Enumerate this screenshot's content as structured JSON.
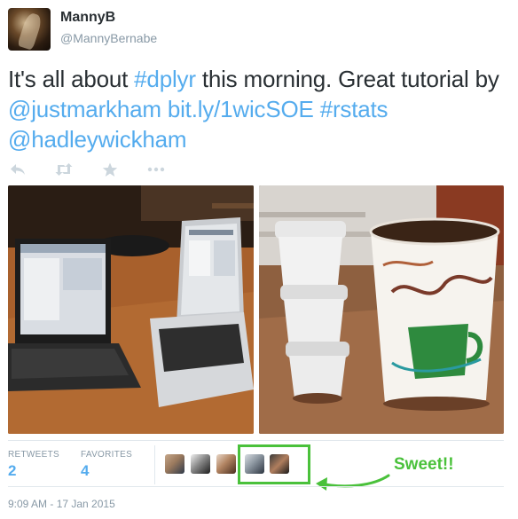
{
  "user": {
    "display_name": "MannyB",
    "handle": "@MannyBernabe"
  },
  "tweet": {
    "text_1": "It's all about ",
    "hashtag_dplyr": "#dplyr",
    "text_2": " this morning.  Great tutorial by ",
    "mention_justmarkham": "@justmarkham",
    "text_3": " ",
    "link": "bit.ly/1wicSOE",
    "text_4": " ",
    "hashtag_rstats": "#rstats",
    "text_5": " ",
    "mention_hadleywickham": "@hadleywickham"
  },
  "actions": {
    "reply_icon": "reply-icon",
    "retweet_icon": "retweet-icon",
    "favorite_icon": "star-icon",
    "more_icon": "more-icon"
  },
  "stats": {
    "retweets_label": "RETWEETS",
    "retweets_value": "2",
    "favorites_label": "FAVORITES",
    "favorites_value": "4"
  },
  "annotation": {
    "label": "Sweet!!",
    "color": "#4ac13b"
  },
  "timestamp": "9:09 AM - 17 Jan 2015",
  "colors": {
    "link": "#55acee",
    "text": "#292f33",
    "muted": "#8899a6"
  }
}
